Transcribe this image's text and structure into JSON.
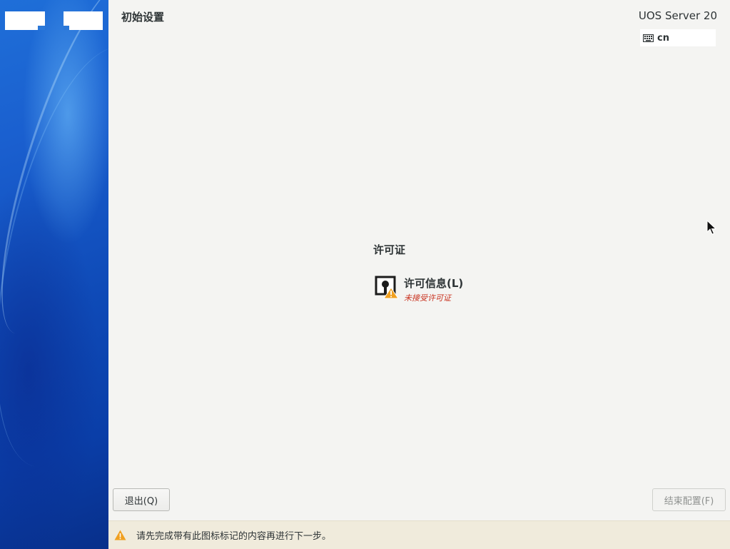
{
  "header": {
    "title": "初始设置",
    "product": "UOS Server 20",
    "keyboard_layout": "cn"
  },
  "main": {
    "category_title": "许可证",
    "spokes": [
      {
        "title": "许可信息(L)",
        "status": "未接受许可证",
        "icon": "license-warning-icon"
      }
    ]
  },
  "buttons": {
    "quit": "退出(Q)",
    "finish": "结束配置(F)"
  },
  "warning_bar": {
    "text": "请先完成带有此图标标记的内容再进行下一步。",
    "icon": "warning-icon"
  },
  "colors": {
    "sidebar_blue": "#1a5fcf",
    "status_red": "#c9321f",
    "warning_bg": "#f0ebdc",
    "warning_orange": "#f0a020"
  }
}
